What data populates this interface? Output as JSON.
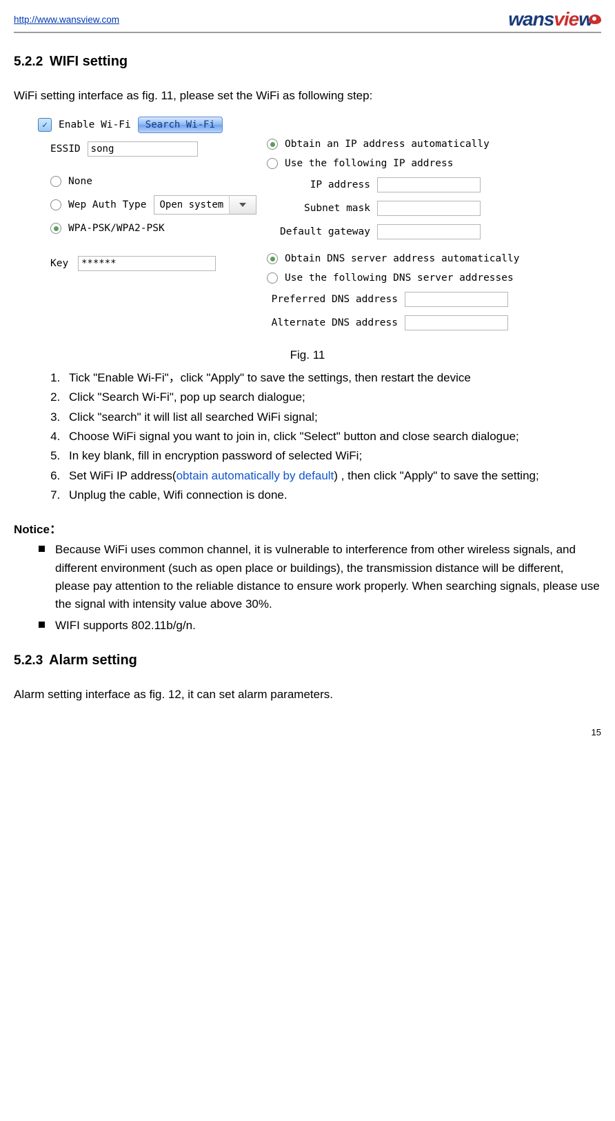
{
  "header": {
    "url": "http://www.wansview.com",
    "brand_a": "wans",
    "brand_b": "vie",
    "brand_c": "w"
  },
  "section1": {
    "num": "5.2.2",
    "title": "WIFI setting",
    "intro": "WiFi setting interface as fig. 11, please set the WiFi as following step:"
  },
  "fig": {
    "enable_label": "Enable Wi-Fi",
    "search_btn": "Search Wi-Fi",
    "essid_label": "ESSID",
    "essid_value": "song",
    "sec_none": "None",
    "sec_wep": "Wep Auth Type",
    "wep_dd": "Open system",
    "sec_wpa": "WPA-PSK/WPA2-PSK",
    "key_label": "Key",
    "key_value": "******",
    "ip_auto": "Obtain an IP address automatically",
    "ip_static": "Use the following IP address",
    "ip_addr": "IP address",
    "subnet": "Subnet mask",
    "gateway": "Default gateway",
    "dns_auto": "Obtain DNS server address automatically",
    "dns_static": "Use the following DNS server addresses",
    "dns_pref": "Preferred DNS address",
    "dns_alt": "Alternate DNS address",
    "caption": "Fig. 11"
  },
  "steps": {
    "s1a": "Tick \"Enable Wi-Fi\"",
    "s1b": "，",
    "s1c": "click \"Apply\" to save the settings, then restart the device",
    "s2": "Click \"Search Wi-Fi\", pop up search dialogue;",
    "s3": "Click \"search\" it will list all searched WiFi signal;",
    "s4": "Choose WiFi signal you want to join in, click \"Select\" button and close search dialogue;",
    "s5": "In key blank, fill in encryption password of selected WiFi;",
    "s6a": "Set WiFi IP address(",
    "s6b": "obtain automatically by default",
    "s6c": ") , then click \"Apply\" to save the setting;",
    "s7": "Unplug the cable, Wifi connection is done."
  },
  "notice": {
    "heading": "Notice：",
    "n1": "Because WiFi uses common channel, it is vulnerable to interference from other wireless signals, and different environment (such as open place or buildings), the transmission distance will be different, please pay attention to the reliable distance to ensure work properly. When searching signals, please use the signal with intensity value above 30%.",
    "n2": "WIFI supports 802.11b/g/n."
  },
  "section2": {
    "num": "5.2.3",
    "title": "Alarm setting",
    "intro": "Alarm setting interface as fig. 12, it can set alarm parameters."
  },
  "pagenum": "15"
}
